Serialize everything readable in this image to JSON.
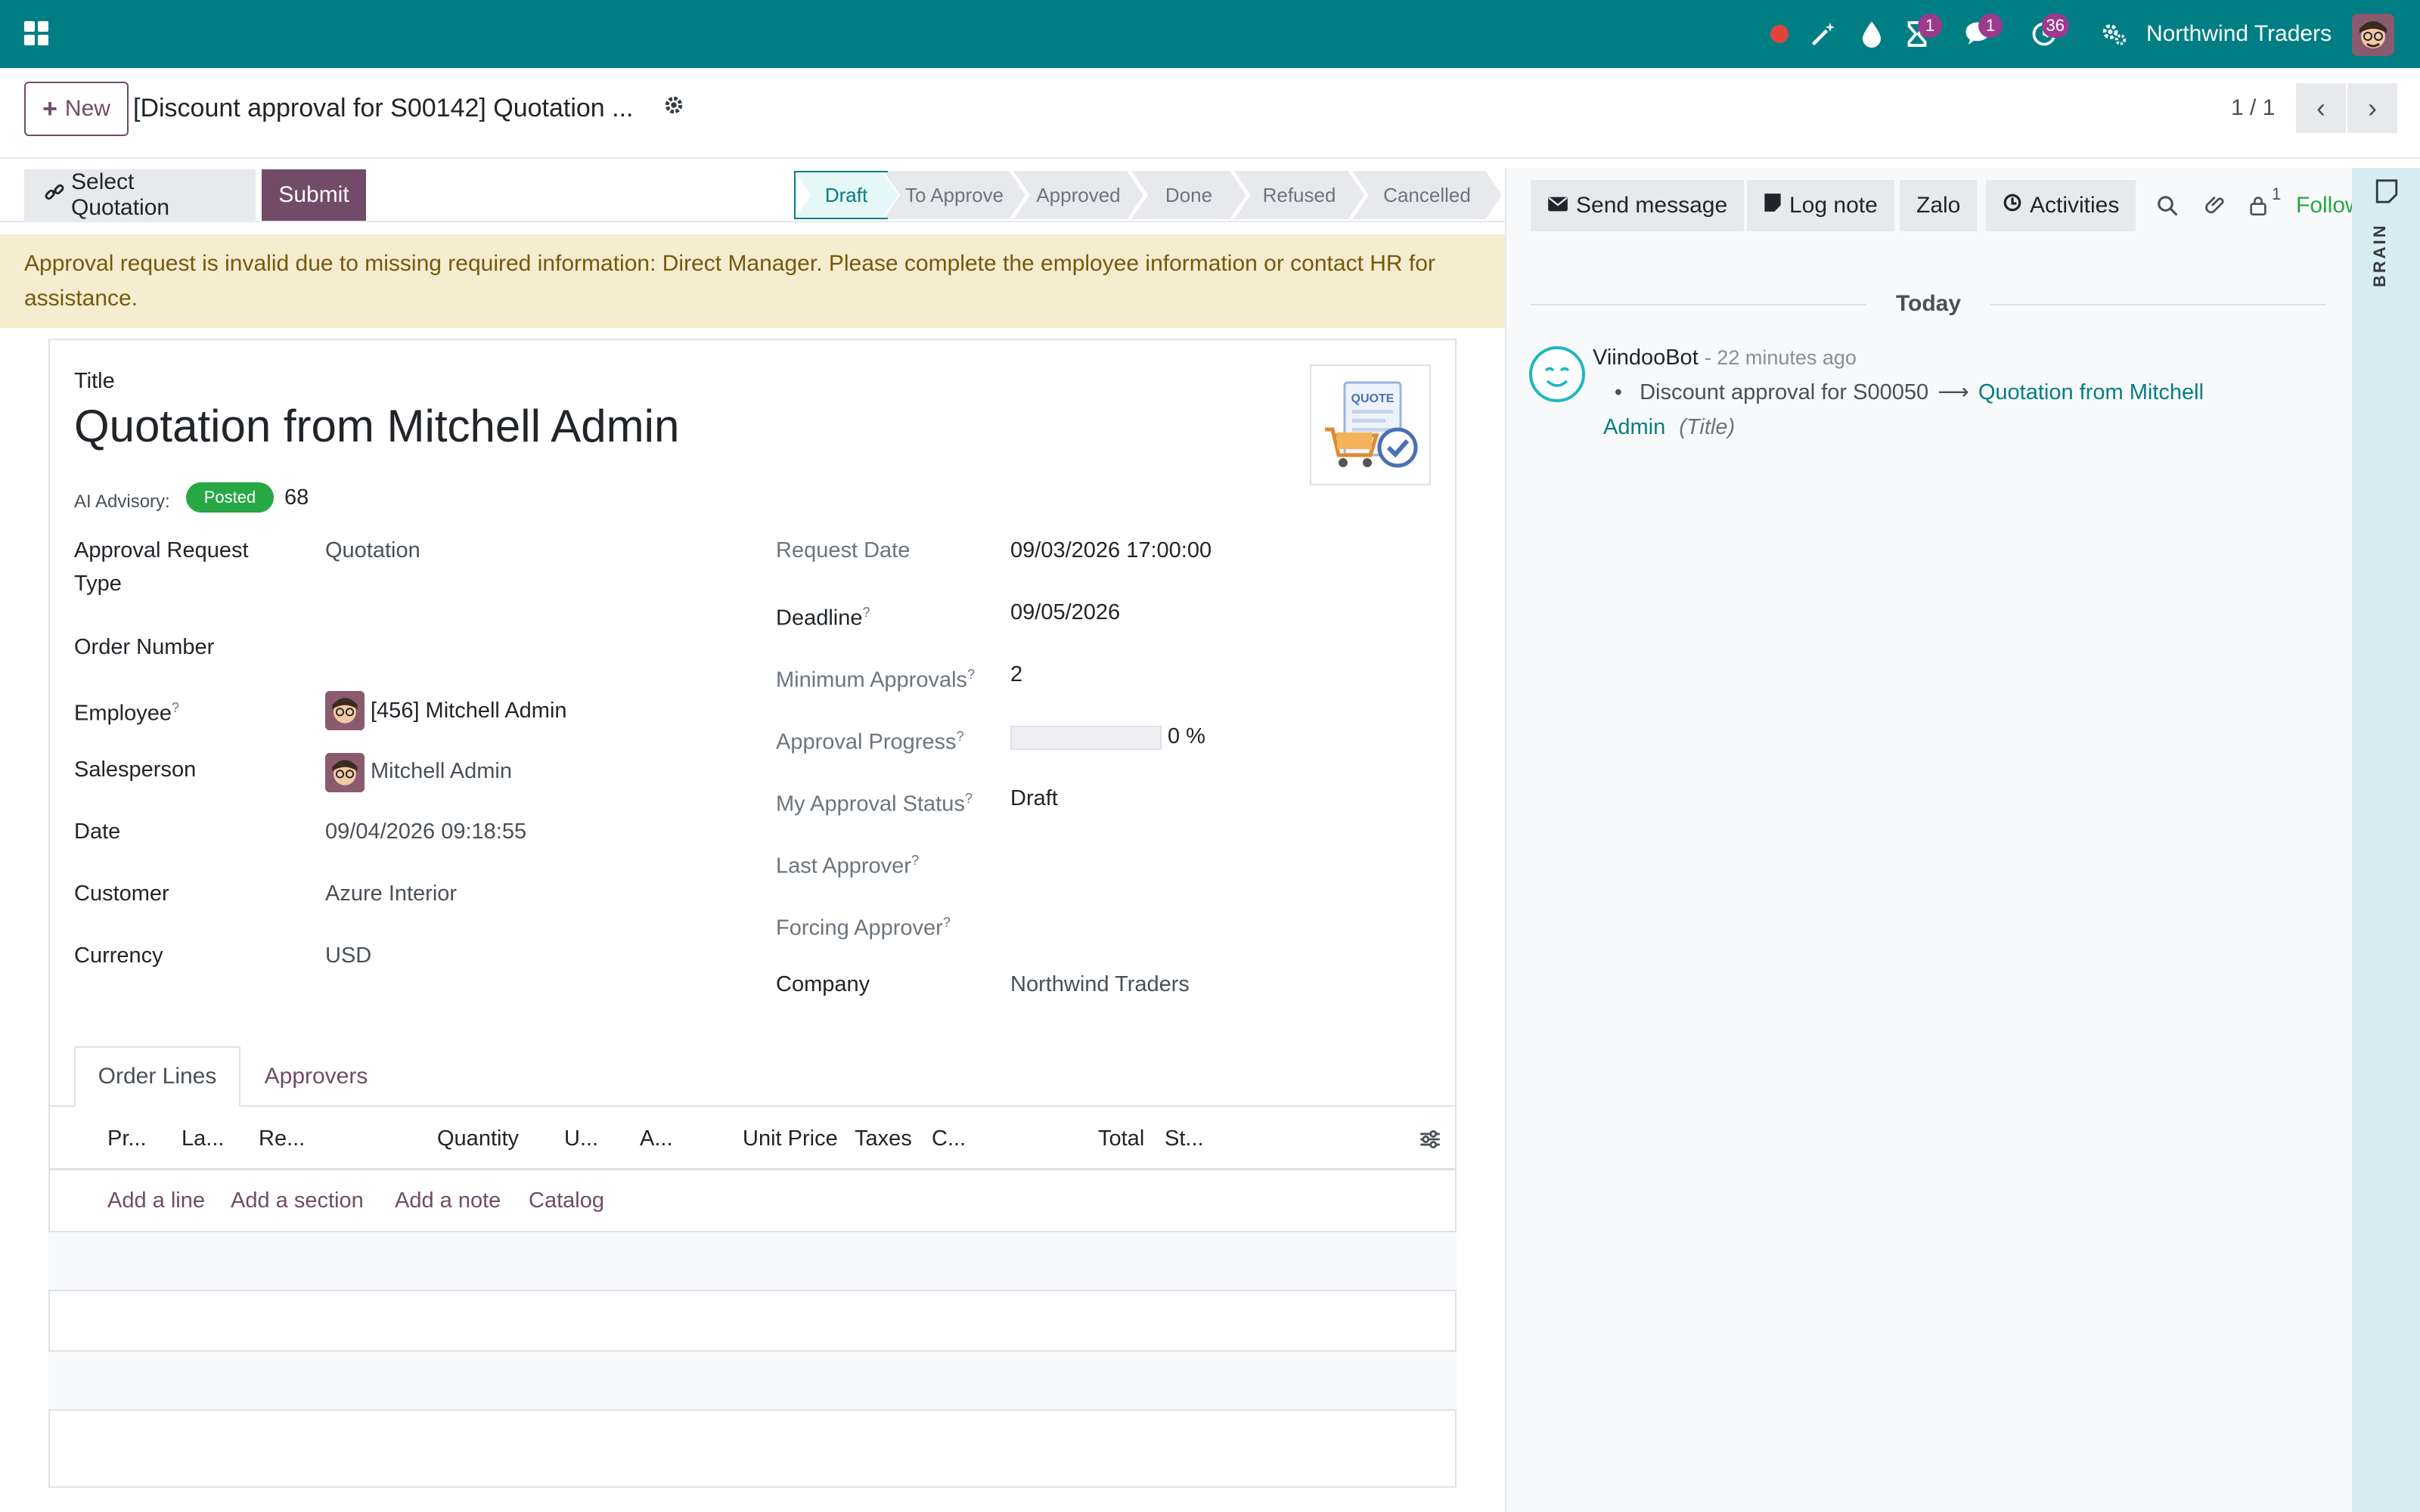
{
  "navbar": {
    "company": "Northwind Traders",
    "badges": {
      "activity": "1",
      "messages": "1",
      "timer": "36"
    },
    "icons": [
      "record-dot-icon",
      "magic-wand-icon",
      "droplet-icon",
      "hourglass-icon",
      "chat-icon",
      "clock-icon",
      "settings-icon"
    ]
  },
  "control_panel": {
    "new_label": "New",
    "record_title": "[Discount approval for S00142] Quotation ...",
    "pager": "1 / 1"
  },
  "statusbar": {
    "select_quotation": "Select Quotation",
    "submit": "Submit",
    "stages": [
      "Draft",
      "To Approve",
      "Approved",
      "Done",
      "Refused",
      "Cancelled"
    ],
    "active_stage": "Draft"
  },
  "alert": "Approval request is invalid due to missing required information: Direct Manager. Please complete the employee information or contact HR for assistance.",
  "form": {
    "title_label": "Title",
    "title": "Quotation from Mitchell Admin",
    "ai_label": "AI Advisory:",
    "ai_badge": "Posted",
    "ai_score": "68",
    "left": {
      "approval_type_label": "Approval Request Type",
      "approval_type": "Quotation",
      "order_number_label": "Order Number",
      "order_number": "",
      "employee_label": "Employee",
      "employee": "[456] Mitchell Admin",
      "salesperson_label": "Salesperson",
      "salesperson": "Mitchell Admin",
      "date_label": "Date",
      "date": "09/04/2026 09:18:55",
      "customer_label": "Customer",
      "customer": "Azure Interior",
      "currency_label": "Currency",
      "currency": "USD"
    },
    "right": {
      "request_date_label": "Request Date",
      "request_date": "09/03/2026 17:00:00",
      "deadline_label": "Deadline",
      "deadline": "09/05/2026",
      "min_approvals_label": "Minimum Approvals",
      "min_approvals": "2",
      "progress_label": "Approval Progress",
      "progress": 0,
      "progress_text": "0 %",
      "my_status_label": "My Approval Status",
      "my_status": "Draft",
      "last_approver_label": "Last Approver",
      "forcing_approver_label": "Forcing Approver",
      "company_label": "Company",
      "company": "Northwind Traders"
    },
    "help_mark": "?",
    "tabs": [
      "Order Lines",
      "Approvers"
    ],
    "columns": [
      "Pr...",
      "La...",
      "Re...",
      "Quantity",
      "U...",
      "A...",
      "Unit Price",
      "Taxes",
      "C...",
      "Total",
      "St..."
    ],
    "add_links": [
      "Add a line",
      "Add a section",
      "Add a note",
      "Catalog"
    ],
    "image_text": "QUOTE"
  },
  "chatter": {
    "send_message": "Send message",
    "log_note": "Log note",
    "zalo": "Zalo",
    "activities": "Activities",
    "followers_count": "1",
    "follow": "Follow",
    "today": "Today",
    "author": "ViindooBot",
    "time": "- 22 minutes ago",
    "change_old": "Discount approval for S00050",
    "change_new": "Quotation from Mitchell Admin",
    "change_field": "(Title)"
  },
  "brain": {
    "label": "BRAIN"
  },
  "colors": {
    "brand": "#017e84",
    "primary": "#714b67",
    "success": "#28a745",
    "alert_bg": "#f6ecd0"
  }
}
